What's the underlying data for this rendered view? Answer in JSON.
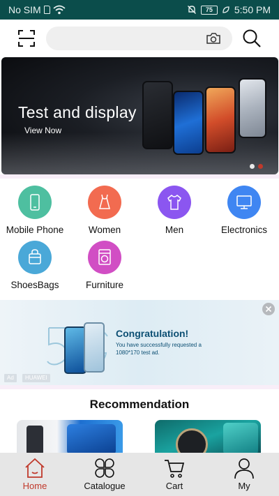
{
  "status_bar": {
    "carrier": "No SIM",
    "battery": "75",
    "time": "5:50 PM"
  },
  "banner": {
    "title": "Test and display",
    "link": "View Now"
  },
  "categories": [
    {
      "label": "Mobile Phone",
      "icon": "mobile-phone-icon",
      "color": "#4ebfa0"
    },
    {
      "label": "Women",
      "icon": "dress-icon",
      "color": "#f26b50"
    },
    {
      "label": "Men",
      "icon": "shirt-icon",
      "color": "#8b56f0"
    },
    {
      "label": "Electronics",
      "icon": "monitor-icon",
      "color": "#3f86f2"
    },
    {
      "label": "ShoesBags",
      "icon": "bag-icon",
      "color": "#4aa8d8"
    },
    {
      "label": "Furniture",
      "icon": "washing-machine-icon",
      "color": "#d14ec4"
    }
  ],
  "ad": {
    "title": "Congratulation!",
    "text": "You have successfully requested a 1080*170 test ad.",
    "tags": [
      "Ad",
      "HUAWEI"
    ]
  },
  "recommendation": {
    "title": "Recommendation"
  },
  "bottom_nav": [
    {
      "label": "Home",
      "icon": "home-icon",
      "active": true
    },
    {
      "label": "Catalogue",
      "icon": "catalogue-icon",
      "active": false
    },
    {
      "label": "Cart",
      "icon": "cart-icon",
      "active": false
    },
    {
      "label": "My",
      "icon": "user-icon",
      "active": false
    }
  ],
  "colors": {
    "status_bar": "#0b4d4b",
    "accent": "#c0392b",
    "nav_bg": "#e6e6e6"
  }
}
